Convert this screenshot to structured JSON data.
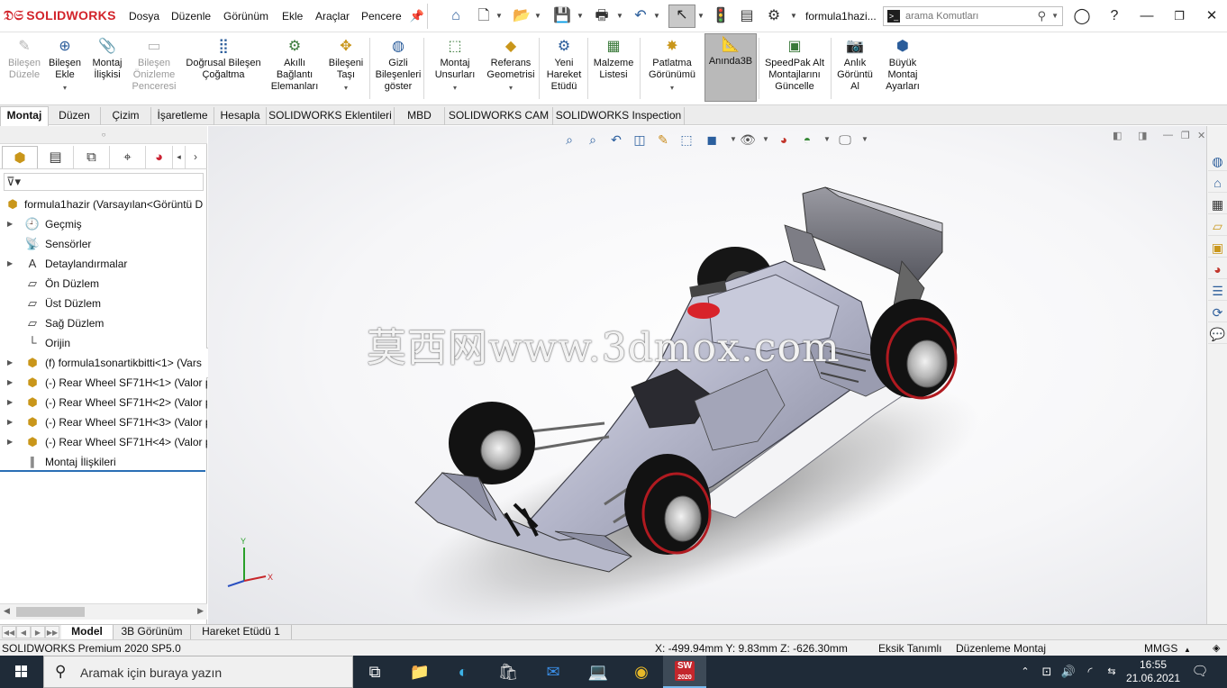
{
  "titlebar": {
    "app_name": "SOLIDWORKS",
    "menus": [
      "Dosya",
      "Düzenle",
      "Görünüm",
      "Ekle",
      "Araçlar",
      "Pencere"
    ],
    "filename": "formula1hazi...",
    "search_placeholder": "arama Komutları"
  },
  "ribbon": {
    "buttons": [
      {
        "label": "Bileşen\nDüzele",
        "icon": "edit-component-icon",
        "disabled": true
      },
      {
        "label": "Bileşen\nEkle",
        "icon": "insert-component-icon",
        "disabled": false
      },
      {
        "label": "Montaj\nİlişkisi",
        "icon": "mate-icon",
        "disabled": false
      },
      {
        "label": "Bileşen\nÖnizleme\nPenceresi",
        "icon": "component-preview-icon",
        "disabled": true
      },
      {
        "label": "Doğrusal Bileşen\nÇoğaltma",
        "icon": "linear-pattern-icon",
        "disabled": false
      },
      {
        "label": "Akıllı\nBağlantı\nElemanları",
        "icon": "smart-fasteners-icon",
        "disabled": false
      },
      {
        "label": "Bileşeni\nTaşı",
        "icon": "move-component-icon",
        "disabled": false
      },
      {
        "label": "Gizli\nBileşenleri\ngöster",
        "icon": "show-hidden-icon",
        "disabled": false
      },
      {
        "label": "Montaj\nUnsurları",
        "icon": "assembly-features-icon",
        "disabled": false
      },
      {
        "label": "Referans\nGeometrisi",
        "icon": "reference-geometry-icon",
        "disabled": false
      },
      {
        "label": "Yeni\nHareket\nEtüdü",
        "icon": "motion-study-icon",
        "disabled": false
      },
      {
        "label": "Malzeme\nListesi",
        "icon": "bill-of-materials-icon",
        "disabled": false
      },
      {
        "label": "Patlatma\nGörünümü",
        "icon": "exploded-view-icon",
        "disabled": false
      },
      {
        "label": "Anında3B",
        "icon": "instant3d-icon",
        "disabled": false,
        "active": true
      },
      {
        "label": "SpeedPak Alt\nMontajlarını\nGüncelle",
        "icon": "speedpak-icon",
        "disabled": false
      },
      {
        "label": "Anlık\nGörüntü\nAl",
        "icon": "snapshot-icon",
        "disabled": false
      },
      {
        "label": "Büyük\nMontaj\nAyarları",
        "icon": "large-assembly-icon",
        "disabled": false
      }
    ]
  },
  "command_tabs": [
    "Montaj",
    "Düzen",
    "Çizim",
    "İşaretleme",
    "Hesapla",
    "SOLIDWORKS Eklentileri",
    "MBD",
    "SOLIDWORKS CAM",
    "SOLIDWORKS Inspection"
  ],
  "feature_tree": {
    "root": "formula1hazir  (Varsayılan<Görüntü D",
    "items": [
      {
        "label": "Geçmiş",
        "icon": "history-folder-icon",
        "expandable": true
      },
      {
        "label": "Sensörler",
        "icon": "sensor-folder-icon",
        "expandable": false
      },
      {
        "label": "Detaylandırmalar",
        "icon": "annotations-icon",
        "expandable": true
      },
      {
        "label": "Ön Düzlem",
        "icon": "plane-icon",
        "expandable": false
      },
      {
        "label": "Üst Düzlem",
        "icon": "plane-icon",
        "expandable": false
      },
      {
        "label": "Sağ Düzlem",
        "icon": "plane-icon",
        "expandable": false
      },
      {
        "label": "Orijin",
        "icon": "origin-icon",
        "expandable": false
      },
      {
        "label": "(f) formula1sonartikbitti<1> (Vars",
        "icon": "subassembly-icon",
        "expandable": true
      },
      {
        "label": "(-) Rear Wheel SF71H<1> (Valor p",
        "icon": "subassembly-icon",
        "expandable": true
      },
      {
        "label": "(-) Rear Wheel SF71H<2> (Valor p",
        "icon": "subassembly-icon",
        "expandable": true
      },
      {
        "label": "(-) Rear Wheel SF71H<3> (Valor p",
        "icon": "subassembly-icon",
        "expandable": true
      },
      {
        "label": "(-) Rear Wheel SF71H<4> (Valor p",
        "icon": "subassembly-icon",
        "expandable": true
      },
      {
        "label": "Montaj İlişkileri",
        "icon": "mates-folder-icon",
        "expandable": false
      }
    ]
  },
  "viewport": {
    "watermark": "莫西网www.3dmox.com",
    "triad": {
      "x": "X",
      "y": "Y"
    }
  },
  "bottom_tabs": [
    "Model",
    "3B Görünüm",
    "Hareket Etüdü 1"
  ],
  "statusbar": {
    "product": "SOLIDWORKS Premium 2020 SP5.0",
    "coords": "X: -499.94mm Y: 9.83mm Z: -626.30mm",
    "definition": "Eksik Tanımlı",
    "mode": "Düzenleme Montaj",
    "units": "MMGS"
  },
  "taskbar": {
    "search_placeholder": "Aramak için buraya yazın",
    "time": "16:55",
    "date": "21.06.2021",
    "sw_badge": "2020"
  }
}
